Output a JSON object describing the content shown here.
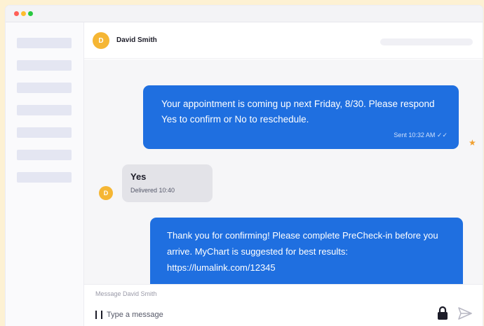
{
  "window": {
    "controls": [
      "close",
      "minimize",
      "maximize"
    ]
  },
  "sidebar": {
    "item_count": 7
  },
  "header": {
    "avatar_initial": "D",
    "contact_name": "David Smith"
  },
  "messages": [
    {
      "direction": "outgoing",
      "text": "Your appointment is coming up next Friday, 8/30. Please respond Yes to confirm or No to reschedule.",
      "meta": "Sent 10:32 AM ✓✓"
    },
    {
      "direction": "incoming",
      "text": "Yes",
      "meta": "Delivered 10:40"
    },
    {
      "direction": "outgoing",
      "text": "Thank you for confirming! Please complete PreCheck-in before you arrive. MyChart is suggested for best results: https://lumalink.com/12345"
    }
  ],
  "composer": {
    "label": "Message David Smith",
    "placeholder": "Type a message"
  },
  "icons": {
    "lock": "lock-icon",
    "send": "send-icon",
    "flag": "star-icon"
  },
  "colors": {
    "accent": "#1f6fe0",
    "avatar": "#f5b634",
    "background": "#fdf1d3"
  }
}
